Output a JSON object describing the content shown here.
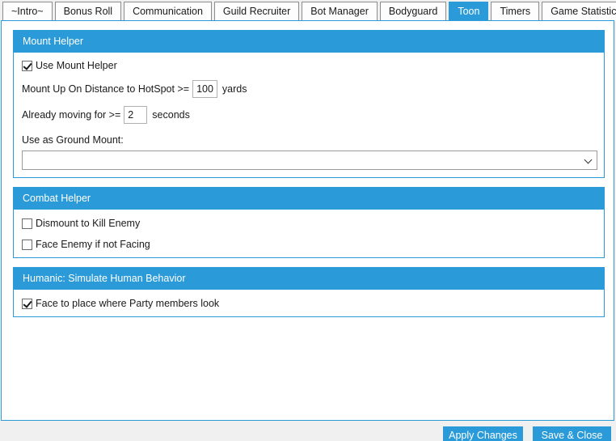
{
  "tabs": [
    {
      "label": "~Intro~"
    },
    {
      "label": "Bonus Roll"
    },
    {
      "label": "Communication"
    },
    {
      "label": "Guild Recruiter"
    },
    {
      "label": "Bot Manager"
    },
    {
      "label": "Bodyguard"
    },
    {
      "label": "Toon"
    },
    {
      "label": "Timers"
    },
    {
      "label": "Game Statistic"
    }
  ],
  "active_tab": "Toon",
  "mount_helper": {
    "title": "Mount Helper",
    "use_mount_helper": {
      "label": "Use Mount Helper",
      "checked": true
    },
    "distance_prefix": "Mount Up On Distance to HotSpot >=",
    "distance_value": "100",
    "distance_suffix": "yards",
    "moving_prefix": "Already moving for >=",
    "moving_value": "2",
    "moving_suffix": "seconds",
    "ground_mount_label": "Use as Ground Mount:",
    "ground_mount_value": ""
  },
  "combat_helper": {
    "title": "Combat Helper",
    "dismount": {
      "label": "Dismount to Kill Enemy",
      "checked": false
    },
    "face_enemy": {
      "label": "Face Enemy if not Facing",
      "checked": false
    }
  },
  "humanic": {
    "title": "Humanic: Simulate Human Behavior",
    "face_party": {
      "label": "Face to place where Party members look",
      "checked": true
    }
  },
  "buttons": {
    "apply": "Apply Changes",
    "save_close": "Save & Close"
  },
  "colors": {
    "accent": "#2a9ad8",
    "background": "#f0f0f0",
    "panel": "#ffffff"
  }
}
